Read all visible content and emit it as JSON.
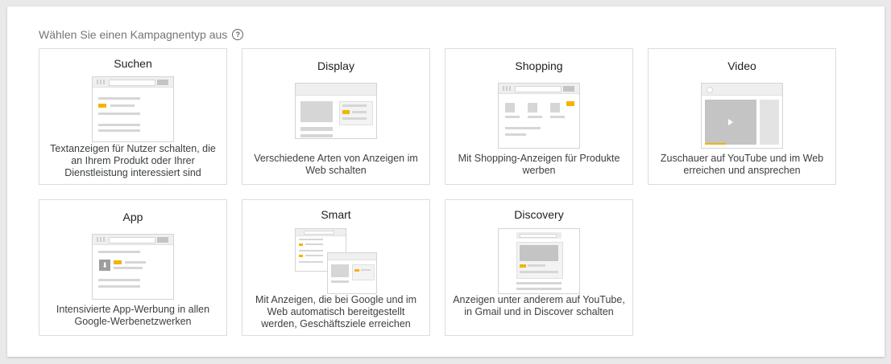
{
  "heading": "Wählen Sie einen Kampagnentyp aus",
  "help_icon": "help-circle-icon",
  "colors": {
    "accent": "#f4b400",
    "border": "#dadce0",
    "muted_text": "#757575"
  },
  "cards": [
    {
      "title": "Suchen",
      "description": "Textanzeigen für Nutzer schalten, die an Ihrem Produkt oder Ihrer Dienstleistung interessiert sind"
    },
    {
      "title": "Display",
      "description": "Verschiedene Arten von Anzeigen im Web schalten"
    },
    {
      "title": "Shopping",
      "description": "Mit Shopping-Anzeigen für Produkte werben"
    },
    {
      "title": "Video",
      "description": "Zuschauer auf YouTube und im Web erreichen und ansprechen"
    },
    {
      "title": "App",
      "description": "Intensivierte App-Werbung in allen Google-Werbenetzwerken"
    },
    {
      "title": "Smart",
      "description": "Mit Anzeigen, die bei Google und im Web automatisch bereitgestellt werden, Geschäftsziele erreichen"
    },
    {
      "title": "Discovery",
      "description": "Anzeigen unter anderem auf YouTube, in Gmail und in Discover schalten"
    }
  ]
}
